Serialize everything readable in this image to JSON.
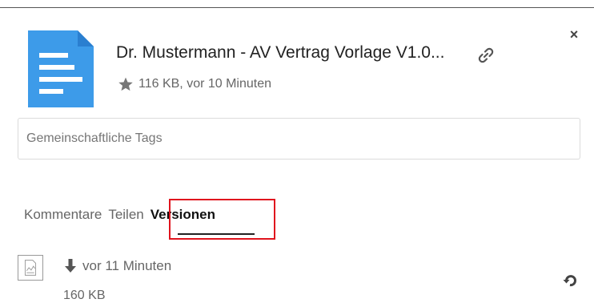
{
  "sidebar": {
    "close_label": "×",
    "file": {
      "title": "Dr. Mustermann - AV Vertrag Vorlage V1.0...",
      "meta": "116 KB, vor 10 Minuten",
      "icon": "document-icon",
      "icon_color": "#3d9be9"
    },
    "tags": {
      "placeholder": "Gemeinschaftliche Tags",
      "value": ""
    },
    "tabs": [
      {
        "label": "Kommentare"
      },
      {
        "label": "Teilen"
      },
      {
        "label": "Versionen",
        "active": true
      }
    ],
    "versions": [
      {
        "time": "vor 11 Minuten",
        "size": "160 KB"
      }
    ],
    "highlight_color": "#e0141e"
  }
}
